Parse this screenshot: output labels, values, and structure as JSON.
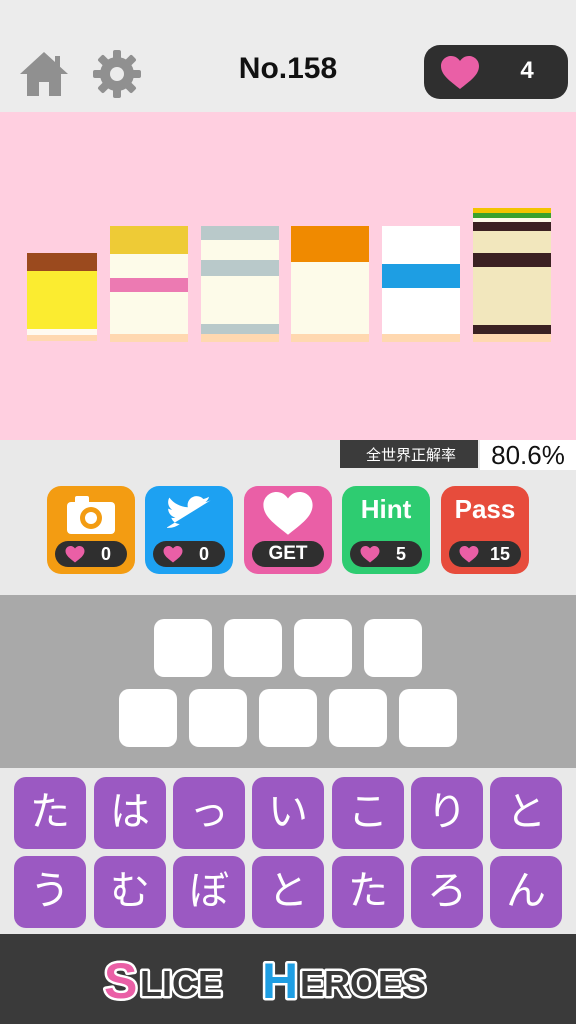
{
  "header": {
    "title": "No.158",
    "hearts": "4",
    "home_icon": "home-icon",
    "settings_icon": "gear-icon"
  },
  "stats": {
    "label": "全世界正解率",
    "value": "80.6%"
  },
  "actions": [
    {
      "name": "camera",
      "label": "",
      "count": "0",
      "color": "#f39c12"
    },
    {
      "name": "twitter",
      "label": "",
      "count": "0",
      "color": "#1da1f2"
    },
    {
      "name": "get-hearts",
      "label": "",
      "count": "GET",
      "color": "#ea5fa6"
    },
    {
      "name": "hint",
      "label": "Hint",
      "count": "5",
      "color": "#2ecc71"
    },
    {
      "name": "pass",
      "label": "Pass",
      "count": "15",
      "color": "#e74c3c"
    }
  ],
  "keyboard": {
    "row1": [
      "た",
      "は",
      "っ",
      "い",
      "こ",
      "り",
      "と"
    ],
    "row2": [
      "う",
      "む",
      "ぼ",
      "と",
      "た",
      "ろ",
      "ん"
    ]
  },
  "answer": {
    "row1_slots": 4,
    "row2_slots": 5
  },
  "footer": {
    "logo_text": "SLICE HEROES"
  },
  "colors": {
    "puzzle_bg": "#ffcfe0",
    "key": "#9b59c2",
    "heart": "#ea5fa6"
  }
}
